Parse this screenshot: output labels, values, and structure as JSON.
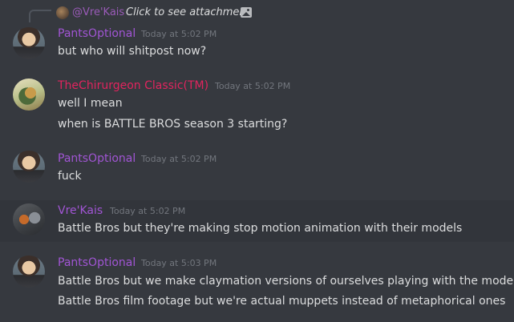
{
  "reply": {
    "author": "@Vre'Kais",
    "text": "Click to see attachment",
    "icon": "image-icon"
  },
  "messages": [
    {
      "author": "PantsOptional",
      "timestamp": "Today at 5:02 PM",
      "avatar_icon": "pantsoptional-avatar",
      "lines": [
        "but who will shitpost now?"
      ]
    },
    {
      "author": "TheChirurgeon Classic(TM)",
      "timestamp": "Today at 5:02 PM",
      "avatar_icon": "thechirurgeon-avatar",
      "lines": [
        "well I mean",
        "when is BATTLE BROS season 3 starting?"
      ]
    },
    {
      "author": "PantsOptional",
      "timestamp": "Today at 5:02 PM",
      "avatar_icon": "pantsoptional-avatar",
      "lines": [
        "fuck"
      ]
    },
    {
      "author": "Vre'Kais",
      "timestamp": "Today at 5:02 PM",
      "avatar_icon": "vrekais-avatar",
      "lines": [
        "Battle Bros but they're making stop motion animation with their models"
      ]
    },
    {
      "author": "PantsOptional",
      "timestamp": "Today at 5:03 PM",
      "avatar_icon": "pantsoptional-avatar",
      "lines": [
        "Battle Bros but we make claymation versions of ourselves playing with the models",
        "Battle Bros film footage but we're actual muppets instead of metaphorical ones"
      ]
    }
  ],
  "colors": {
    "background": "#36393f",
    "highlight_row": "#32353b",
    "username_purple": "#a155d4",
    "username_red": "#e0245e",
    "timestamp": "#72767d",
    "message_text": "#dcddde"
  }
}
